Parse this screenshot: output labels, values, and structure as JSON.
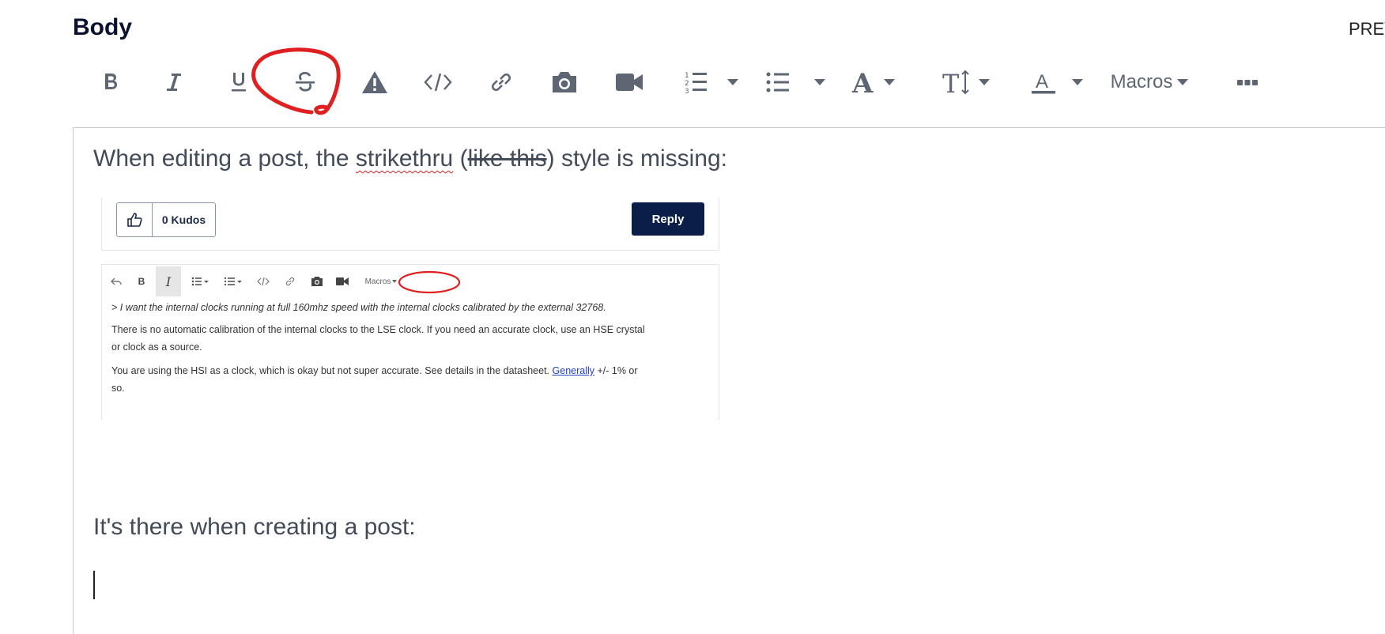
{
  "header": {
    "title": "Body",
    "preview_label": "PREVIEW"
  },
  "toolbar": {
    "buttons": [
      {
        "name": "bold",
        "icon": "bold-icon"
      },
      {
        "name": "italic",
        "icon": "italic-icon"
      },
      {
        "name": "underline",
        "icon": "underline-icon"
      },
      {
        "name": "strikethrough",
        "icon": "strikethrough-icon"
      },
      {
        "name": "spoiler",
        "icon": "warning-icon"
      },
      {
        "name": "code",
        "icon": "code-icon"
      },
      {
        "name": "link",
        "icon": "link-icon"
      },
      {
        "name": "image",
        "icon": "camera-icon"
      },
      {
        "name": "video",
        "icon": "video-icon"
      },
      {
        "name": "ordered-list",
        "icon": "ordered-list-icon"
      },
      {
        "name": "bullet-list",
        "icon": "bullet-list-icon"
      },
      {
        "name": "font-family",
        "icon": "font-icon"
      },
      {
        "name": "font-size",
        "icon": "text-size-icon"
      },
      {
        "name": "text-color",
        "icon": "text-color-icon"
      },
      {
        "name": "more",
        "icon": "more-icon"
      }
    ],
    "macros_label": "Macros",
    "annotation_color": "#e02020"
  },
  "editor": {
    "paragraph1": {
      "part1": "When editing a post, the ",
      "misspelled": "strikethru",
      "part2": " (",
      "struck": "like this",
      "part3": ") style is missing:"
    },
    "paragraph2": "It's there when creating a post:"
  },
  "embedded_screenshot": {
    "kudos_label": "0 Kudos",
    "reply_label": "Reply",
    "reply_color": "#0b1e4a",
    "mini_toolbar": {
      "bold": "B",
      "italic": "I",
      "macros": "Macros"
    },
    "quote": "> I want the internal clocks running at full 160mhz speed with the internal clocks calibrated by the external 32768.",
    "line1": "There is no automatic calibration of the internal clocks to the LSE clock. If you need an accurate clock, use an HSE crystal",
    "line2": "or clock as a source.",
    "line3_pre": "You are using the HSI as a clock, which is okay but not super accurate. See details in the datasheet. ",
    "line3_link": "Generally",
    "line3_post": " +/- 1% or",
    "line4": "so."
  }
}
